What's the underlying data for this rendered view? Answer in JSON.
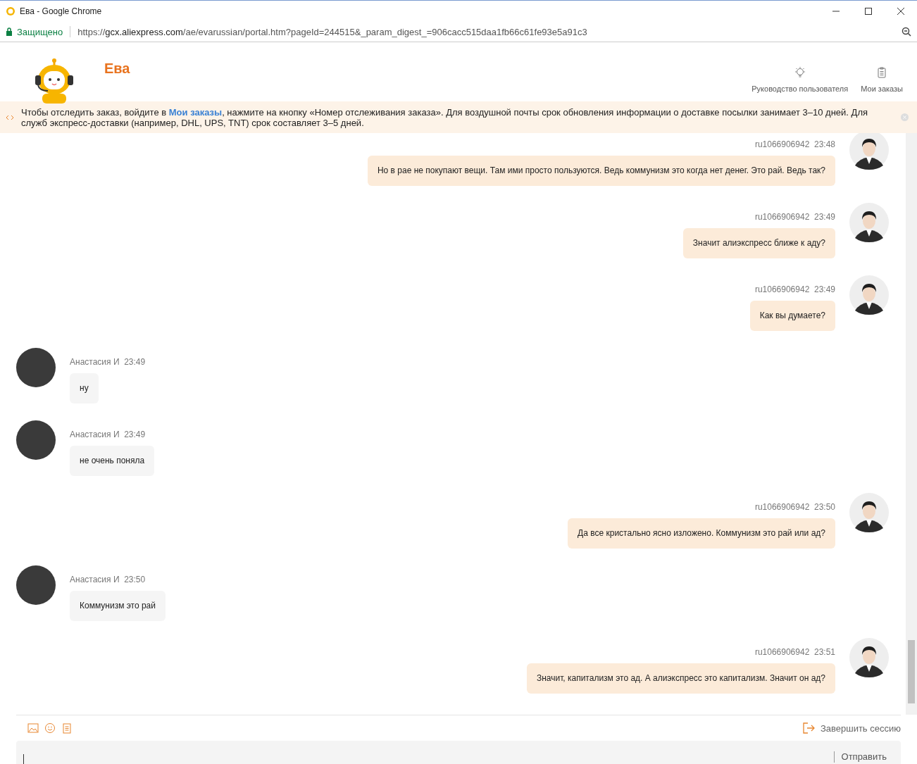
{
  "window": {
    "title": "Ева - Google Chrome"
  },
  "address_bar": {
    "secure_label": "Защищено",
    "url_scheme": "https://",
    "url_host": "gcx.aliexpress.com",
    "url_path": "/ae/evarussian/portal.htm?pageId=244515&_param_digest_=906cacc515daa1fb66c61fe93e5a91c3"
  },
  "header": {
    "title": "Ева",
    "actions": [
      {
        "label": "Руководство пользователя",
        "kind": "guide"
      },
      {
        "label": "Мои заказы",
        "kind": "orders"
      }
    ]
  },
  "notice": {
    "text": "Чтобы отследить заказ, войдите в **Мои заказы**, нажмите на кнопку «Номер отслеживания заказа». Для воздушной почты срок обновления информации о доставке посылки занимает 3–10 дней. Для служб экспресс-доставки (например, DHL, UPS, TNT) срок составляет 3–5 дней."
  },
  "messages": [
    {
      "kind": "user",
      "name": "ru1066906942",
      "time": "23:48",
      "text": "Но в рае не покупают вещи. Там ими просто пользуются. Ведь коммунизм это когда нет денег. Это рай. Ведь так?"
    },
    {
      "kind": "user",
      "name": "ru1066906942",
      "time": "23:49",
      "text": "Значит алиэкспресс ближе к аду?"
    },
    {
      "kind": "user",
      "name": "ru1066906942",
      "time": "23:49",
      "text": "Как вы думаете?"
    },
    {
      "kind": "agent",
      "name": "Анастасия И",
      "time": "23:49",
      "text": "ну"
    },
    {
      "kind": "agent",
      "name": "Анастасия И",
      "time": "23:49",
      "text": "не очень поняла"
    },
    {
      "kind": "user",
      "name": "ru1066906942",
      "time": "23:50",
      "text": "Да все кристально ясно изложено. Коммунизм это рай или ад?"
    },
    {
      "kind": "agent",
      "name": "Анастасия И",
      "time": "23:50",
      "text": "Коммунизм это рай"
    },
    {
      "kind": "user",
      "name": "ru1066906942",
      "time": "23:51",
      "text": "Значит, капитализм это ад. А алиэкспресс это капитализм. Значит он ад?"
    }
  ],
  "composer": {
    "end_session": "Завершить сессию",
    "send": "Отправить"
  }
}
